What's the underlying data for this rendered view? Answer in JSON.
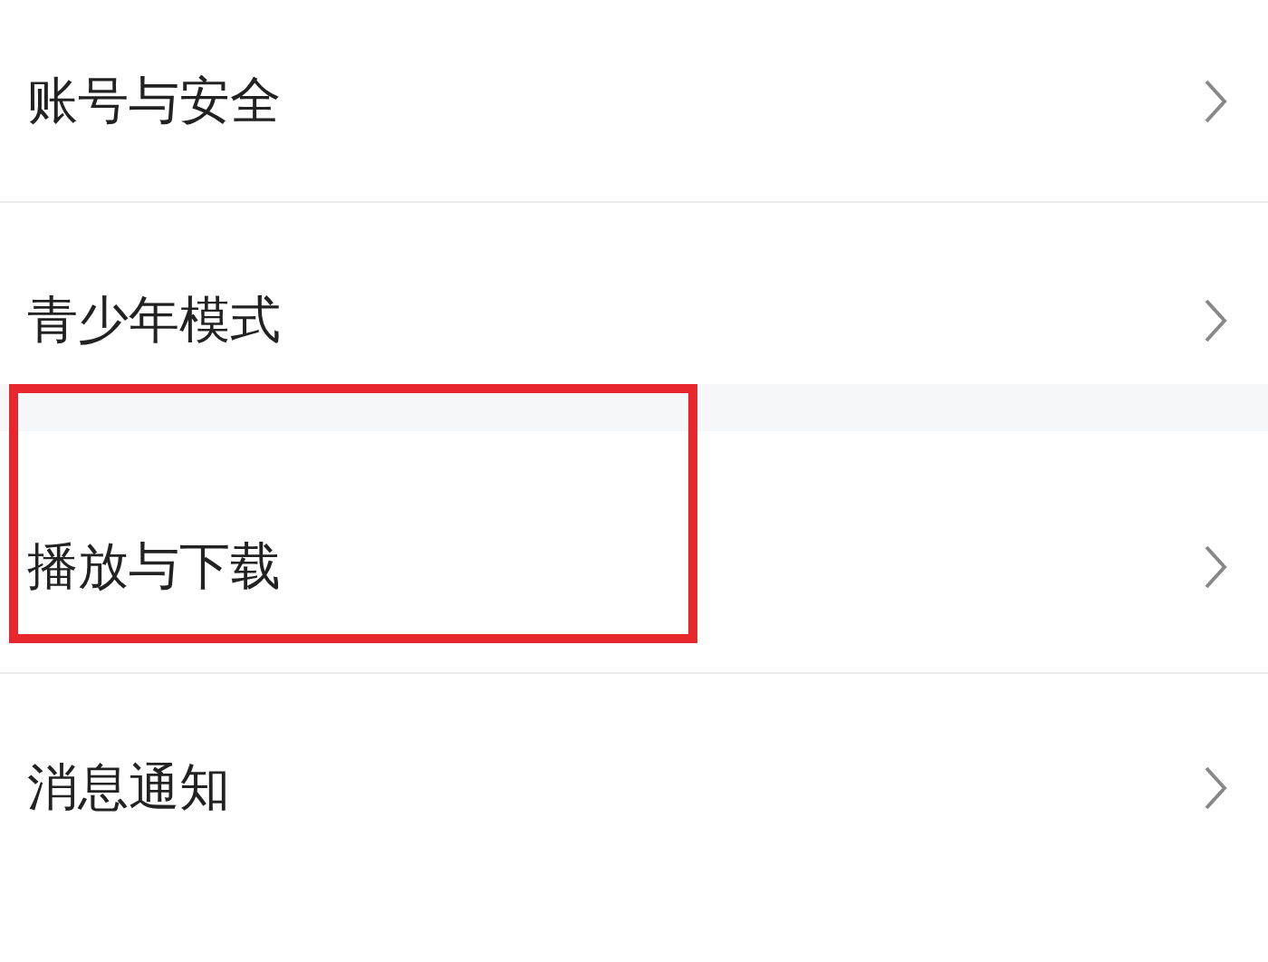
{
  "settings_items": [
    {
      "label": "账号与安全",
      "highlighted": false
    },
    {
      "label": "青少年模式",
      "highlighted": false
    },
    {
      "label": "播放与下载",
      "highlighted": true
    },
    {
      "label": "消息通知",
      "highlighted": false
    }
  ]
}
